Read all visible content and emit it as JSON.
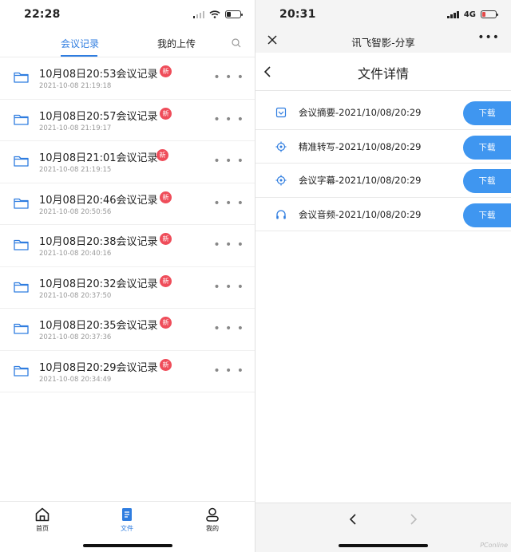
{
  "left": {
    "status": {
      "time": "22:28"
    },
    "tabs": [
      {
        "label": "会议记录",
        "active": true
      },
      {
        "label": "我的上传",
        "active": false
      }
    ],
    "items": [
      {
        "title": "10月08日20:53会议记录",
        "badge": "新",
        "date": "2021-10-08 21:19:18"
      },
      {
        "title": "10月08日20:57会议记录",
        "badge": "新",
        "date": "2021-10-08 21:19:17"
      },
      {
        "title": "10月08日21:01会议记录",
        "badge": "新",
        "date": "2021-10-08 21:19:15"
      },
      {
        "title": "10月08日20:46会议记录",
        "badge": "新",
        "date": "2021-10-08 20:50:56"
      },
      {
        "title": "10月08日20:38会议记录",
        "badge": "新",
        "date": "2021-10-08 20:40:16"
      },
      {
        "title": "10月08日20:32会议记录",
        "badge": "新",
        "date": "2021-10-08 20:37:50"
      },
      {
        "title": "10月08日20:35会议记录",
        "badge": "新",
        "date": "2021-10-08 20:37:36"
      },
      {
        "title": "10月08日20:29会议记录",
        "badge": "新",
        "date": "2021-10-08 20:34:49"
      }
    ],
    "more_glyph": "• • •",
    "bottom_nav": [
      {
        "label": "首页",
        "icon": "home-icon",
        "active": false
      },
      {
        "label": "文件",
        "icon": "file-icon",
        "active": true
      },
      {
        "label": "我的",
        "icon": "profile-icon",
        "active": false
      }
    ]
  },
  "right": {
    "status": {
      "time": "20:31",
      "network": "4G"
    },
    "window_title": "讯飞智影-分享",
    "menu_glyph": "•••",
    "page_title": "文件详情",
    "files": [
      {
        "name": "会议摘要-2021/10/08/20:29",
        "icon": "summary-icon",
        "action": "下载"
      },
      {
        "name": "精准转写-2021/10/08/20:29",
        "icon": "target-icon",
        "action": "下载"
      },
      {
        "name": "会议字幕-2021/10/08/20:29",
        "icon": "target-icon",
        "action": "下载"
      },
      {
        "name": "会议音频-2021/10/08/20:29",
        "icon": "headphones-icon",
        "action": "下载"
      }
    ],
    "watermark": "PConline"
  },
  "colors": {
    "accent": "#2f7de0",
    "badge": "#ef4d5a",
    "download": "#3f96f0"
  }
}
